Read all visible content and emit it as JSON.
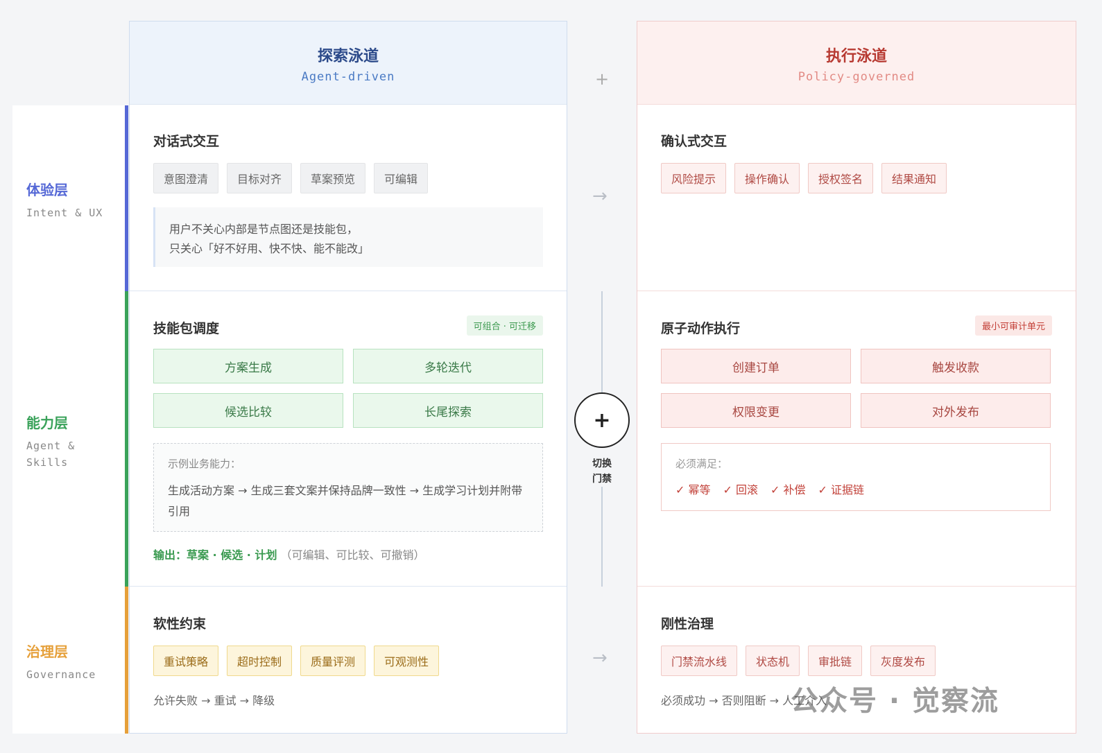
{
  "layers": [
    {
      "title": "体验层",
      "subtitle": "Intent & UX",
      "color": "#5568d6"
    },
    {
      "title": "能力层",
      "subtitle": "Agent & Skills",
      "color": "#3aa25a"
    },
    {
      "title": "治理层",
      "subtitle": "Governance",
      "color": "#e6a03a"
    }
  ],
  "left_column": {
    "title": "探索泳道",
    "subtitle": "Agent-driven",
    "title_color": "#2c4a8a",
    "subtitle_color": "#4a7ac4",
    "experience": {
      "title": "对话式交互",
      "chips": [
        "意图澄清",
        "目标对齐",
        "草案预览",
        "可编辑"
      ],
      "quote_line1": "用户不关心内部是节点图还是技能包，",
      "quote_line2": "只关心「好不好用、快不快、能不能改」"
    },
    "capability": {
      "title": "技能包调度",
      "tag": "可组合 · 可迁移",
      "buttons": [
        "方案生成",
        "多轮迭代",
        "候选比较",
        "长尾探索"
      ],
      "example_label": "示例业务能力：",
      "example_text": "生成活动方案 → 生成三套文案并保持品牌一致性 → 生成学习计划并附带引用",
      "output_label": "输出：草案 · 候选 · 计划",
      "output_note": "（可编辑、可比较、可撤销）"
    },
    "governance": {
      "title": "软性约束",
      "chips": [
        "重试策略",
        "超时控制",
        "质量评测",
        "可观测性"
      ],
      "note": "允许失败 → 重试 → 降级"
    }
  },
  "right_column": {
    "title": "执行泳道",
    "subtitle": "Policy-governed",
    "title_color": "#b73a32",
    "subtitle_color": "#e28a84",
    "experience": {
      "title": "确认式交互",
      "chips": [
        "风险提示",
        "操作确认",
        "授权签名",
        "结果通知"
      ]
    },
    "capability": {
      "title": "原子动作执行",
      "tag": "最小可审计单元",
      "buttons": [
        "创建订单",
        "触发收款",
        "权限变更",
        "对外发布"
      ],
      "must_label": "必须满足：",
      "must_items": [
        "✓ 幂等",
        "✓ 回滚",
        "✓ 补偿",
        "✓ 证据链"
      ]
    },
    "governance": {
      "title": "刚性治理",
      "chips": [
        "门禁流水线",
        "状态机",
        "审批链",
        "灰度发布"
      ],
      "note": "必须成功 → 否则阻断 → 人工介入"
    }
  },
  "center": {
    "top_plus": "+",
    "arrow1": "→",
    "switch_symbol": "+",
    "switch_label_1": "切换",
    "switch_label_2": "门禁",
    "arrow2": "→"
  },
  "watermark": "公众号 · 觉察流"
}
